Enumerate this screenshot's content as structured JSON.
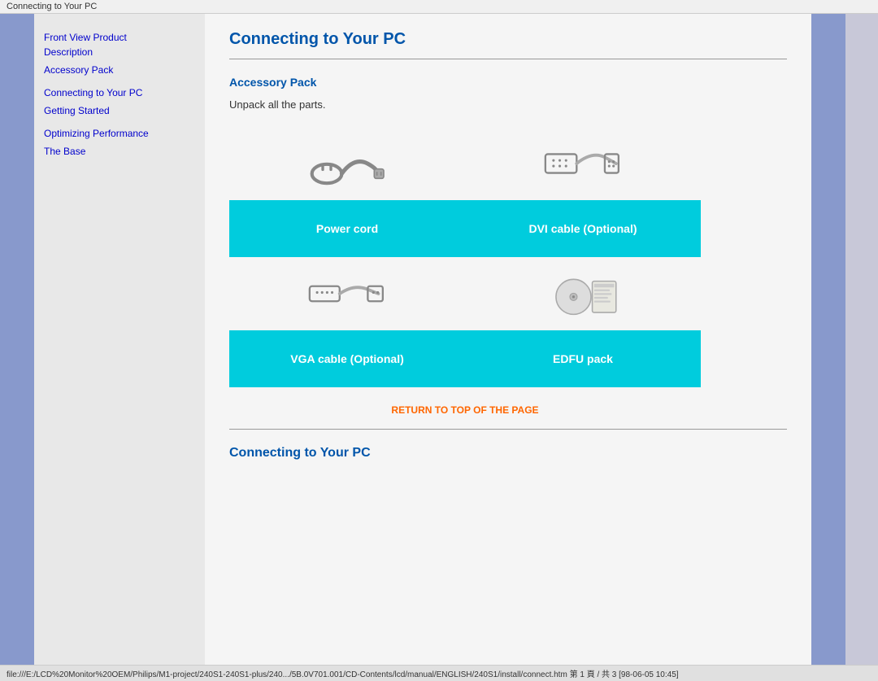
{
  "window": {
    "title": "Connecting to Your PC",
    "status_bar": "file:///E:/LCD%20Monitor%20OEM/Philips/M1-project/240S1-240S1-plus/240.../5B.0V701.001/CD-Contents/lcd/manual/ENGLISH/240S1/install/connect.htm 第 1 頁 / 共 3 [98-06-05 10:45]"
  },
  "sidebar": {
    "links": [
      {
        "label": "Front View Product Description",
        "id": "front-view"
      },
      {
        "label": "Accessory Pack",
        "id": "accessory-pack-link"
      },
      {
        "label": "Connecting to Your PC",
        "id": "connecting-link"
      },
      {
        "label": "Getting Started",
        "id": "getting-started-link"
      },
      {
        "label": "Optimizing Performance",
        "id": "optimizing-link"
      },
      {
        "label": "The Base",
        "id": "base-link"
      }
    ]
  },
  "main": {
    "page_title": "Connecting to Your PC",
    "accessory_section": {
      "title": "Accessory Pack",
      "subtitle": "Unpack all the parts.",
      "items": [
        {
          "id": "power-cord",
          "label": "Power cord"
        },
        {
          "id": "dvi-cable",
          "label": "DVI cable (Optional)"
        },
        {
          "id": "vga-cable",
          "label": "VGA cable (Optional)"
        },
        {
          "id": "edfu-pack",
          "label": "EDFU pack"
        }
      ]
    },
    "return_link": "RETURN TO TOP OF THE PAGE",
    "bottom_section_title": "Connecting to Your PC"
  }
}
